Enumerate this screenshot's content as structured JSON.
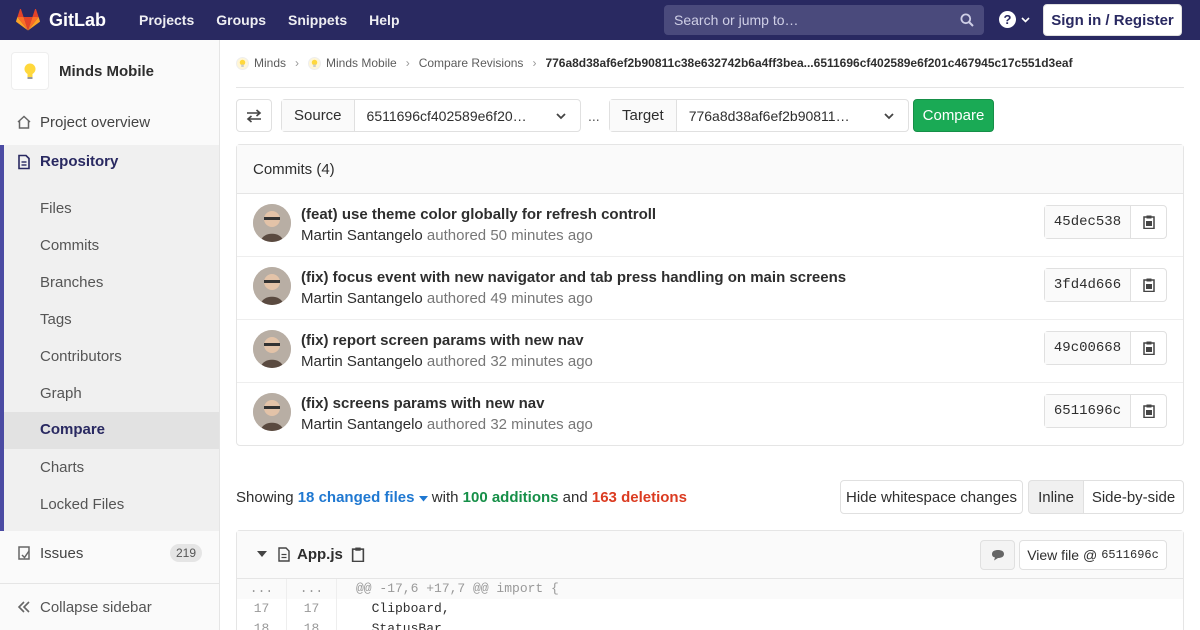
{
  "navbar": {
    "brand": "GitLab",
    "links": [
      "Projects",
      "Groups",
      "Snippets",
      "Help"
    ],
    "search_placeholder": "Search or jump to…",
    "help_icon": "?",
    "signin": "Sign in / Register"
  },
  "sidebar": {
    "project_name": "Minds Mobile",
    "project_overview": "Project overview",
    "repository": "Repository",
    "repo_items": [
      "Files",
      "Commits",
      "Branches",
      "Tags",
      "Contributors",
      "Graph",
      "Compare",
      "Charts",
      "Locked Files"
    ],
    "active_item": "Compare",
    "issues": "Issues",
    "issues_count": "219",
    "collapse": "Collapse sidebar"
  },
  "breadcrumb": {
    "items": [
      "Minds",
      "Minds Mobile",
      "Compare Revisions"
    ],
    "current": "776a8d38af6ef2b90811c38e632742b6a4ff3bea...6511696cf402589e6f201c467945c17c551d3eaf"
  },
  "compare": {
    "source_label": "Source",
    "source_value": "6511696cf402589e6f20…",
    "ellipsis": "...",
    "target_label": "Target",
    "target_value": "776a8d38af6ef2b90811…",
    "compare_button": "Compare"
  },
  "commits": {
    "header": "Commits (4)",
    "authored_label": "authored",
    "items": [
      {
        "title": "(feat) use theme color globally for refresh controll",
        "author": "Martin Santangelo",
        "time": "50 minutes ago",
        "sha": "45dec538"
      },
      {
        "title": "(fix) focus event with new navigator and tab press handling on main screens",
        "author": "Martin Santangelo",
        "time": "49 minutes ago",
        "sha": "3fd4d666"
      },
      {
        "title": "(fix) report screen params with new nav",
        "author": "Martin Santangelo",
        "time": "32 minutes ago",
        "sha": "49c00668"
      },
      {
        "title": "(fix) screens params with new nav",
        "author": "Martin Santangelo",
        "time": "32 minutes ago",
        "sha": "6511696c"
      }
    ]
  },
  "summary": {
    "showing": "Showing",
    "files": "18 changed files",
    "with": "with",
    "additions": "100 additions",
    "and": "and",
    "deletions": "163 deletions"
  },
  "diff_controls": {
    "hide_whitespace": "Hide whitespace changes",
    "inline": "Inline",
    "side_by_side": "Side-by-side"
  },
  "file": {
    "name": "App.js",
    "view_file_label": "View file @",
    "view_file_sha": "6511696c",
    "lines": [
      {
        "old": "...",
        "new": "...",
        "code": "@@ -17,6 +17,7 @@ import {"
      },
      {
        "old": "17",
        "new": "17",
        "code": "  Clipboard,"
      },
      {
        "old": "18",
        "new": "18",
        "code": "  StatusBar,"
      }
    ]
  },
  "colors": {
    "navbar": "#292961",
    "accent": "#4b4ba3",
    "compare_green": "#1aaa55",
    "additions": "#168f48",
    "deletions": "#db3b21",
    "link_blue": "#1f78d1"
  }
}
